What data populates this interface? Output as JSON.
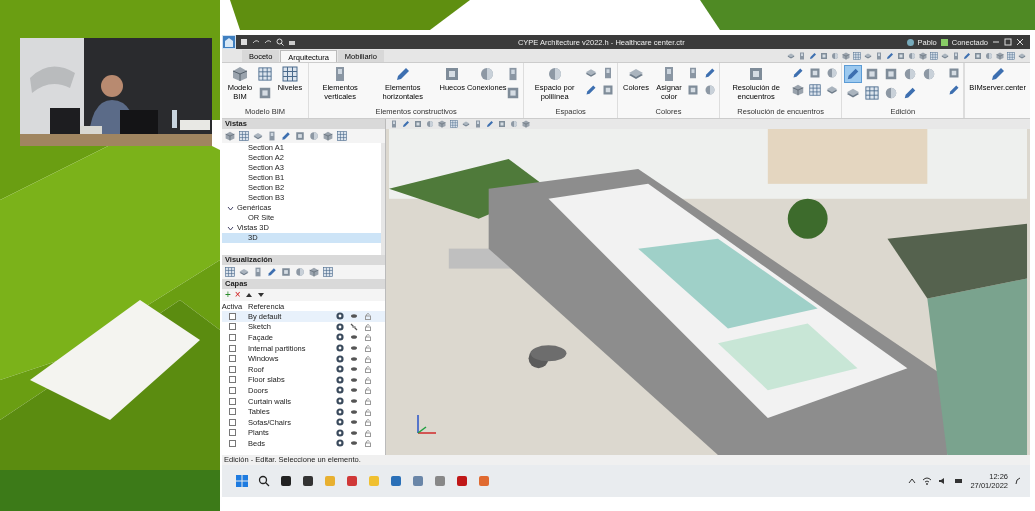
{
  "window": {
    "title": "CYPE Architecture v2022.h - Healthcare center.ctr",
    "user": "Pablo",
    "connection": "Conectado"
  },
  "tabs": [
    {
      "label": "Boceto",
      "selected": false
    },
    {
      "label": "Arquitectura",
      "selected": true
    },
    {
      "label": "Mobiliario",
      "selected": false
    }
  ],
  "ribbon_groups": [
    {
      "title": "Modelo BIM",
      "buttons": [
        "Modelo BIM",
        "Niveles"
      ]
    },
    {
      "title": "Elementos constructivos",
      "buttons": [
        "Elementos verticales",
        "Elementos horizontales",
        "Huecos",
        "Conexiones"
      ]
    },
    {
      "title": "Espacios",
      "buttons": [
        "Espacio por polilínea"
      ]
    },
    {
      "title": "Colores",
      "buttons": [
        "Colores",
        "Asignar color"
      ]
    },
    {
      "title": "Resolución de encuentros",
      "buttons": [
        "Resolución de encuentros"
      ]
    },
    {
      "title": "Edición"
    },
    {
      "buttons": [
        "BIMserver.center"
      ]
    }
  ],
  "edition_tools": [
    {
      "selected": true
    },
    {
      "selected": false
    },
    {
      "selected": false
    },
    {
      "selected": false
    },
    {
      "selected": false
    },
    {
      "selected": false
    },
    {
      "selected": false
    },
    {
      "selected": false
    },
    {
      "selected": false
    }
  ],
  "views": {
    "title": "Vistas",
    "continued_items": [
      "Section A1",
      "Section A2",
      "Section A3",
      "Section B1",
      "Section B2",
      "Section B3"
    ],
    "tree": [
      {
        "label": "Genéricas",
        "expanded": true,
        "children": [
          {
            "label": "OR Site",
            "selected": false
          }
        ]
      },
      {
        "label": "Vistas 3D",
        "expanded": true,
        "children": [
          {
            "label": "3D",
            "selected": true
          }
        ]
      }
    ]
  },
  "display": {
    "title": "Visualización"
  },
  "layers": {
    "title": "Capas",
    "toolbar": [
      "+",
      "×"
    ],
    "columns": [
      "Activa",
      "Referencia"
    ],
    "rows": [
      {
        "name": "By default",
        "active": false,
        "visible": true
      },
      {
        "name": "Sketch",
        "active": false,
        "visible": false
      },
      {
        "name": "Façade",
        "active": false,
        "visible": true
      },
      {
        "name": "Internal partitions",
        "active": false,
        "visible": true
      },
      {
        "name": "Windows",
        "active": false,
        "visible": true
      },
      {
        "name": "Roof",
        "active": false,
        "visible": true
      },
      {
        "name": "Floor slabs",
        "active": false,
        "visible": true
      },
      {
        "name": "Doors",
        "active": false,
        "visible": true
      },
      {
        "name": "Curtain walls",
        "active": false,
        "visible": true
      },
      {
        "name": "Tables",
        "active": false,
        "visible": true
      },
      {
        "name": "Sofas/Chairs",
        "active": false,
        "visible": true
      },
      {
        "name": "Plants",
        "active": false,
        "visible": true
      },
      {
        "name": "Beds",
        "active": false,
        "visible": true
      }
    ]
  },
  "status_bar": "Edición - Editar. Seleccione un elemento.",
  "taskbar": {
    "time": "12:26",
    "date": "27/01/2022"
  }
}
